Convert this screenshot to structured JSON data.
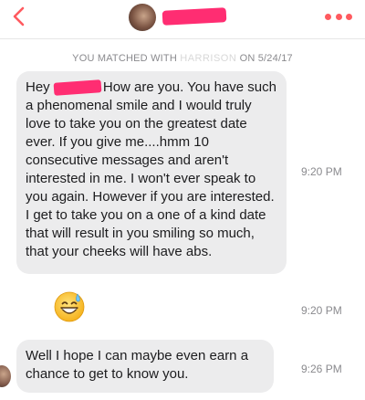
{
  "header": {
    "back_icon": "chevron-left-icon",
    "more_icon": "more-dots-icon",
    "accent_color": "#ff5a5f",
    "redaction_color": "#ff2d72"
  },
  "match_banner": {
    "prefix": "YOU MATCHED WITH",
    "redacted_name": "HARRISON",
    "suffix": "ON 5/24/17"
  },
  "messages": [
    {
      "greeting": "Hey",
      "text": "How are you. You have such a phenomenal smile and I would truly love to take you on the greatest date ever. If you give me....hmm 10 consecutive messages and aren't interested in me. I won't ever speak to you again. However if you are interested. I get to take you on a one of a kind date that will result in you smiling so much, that your cheeks will have abs.",
      "time": "9:20 PM"
    },
    {
      "emoji": "grinning-face-with-sweat-emoji",
      "time": "9:20 PM"
    },
    {
      "text": "Well I hope I can maybe even earn a chance to get to know you.",
      "time": "9:26 PM"
    }
  ]
}
